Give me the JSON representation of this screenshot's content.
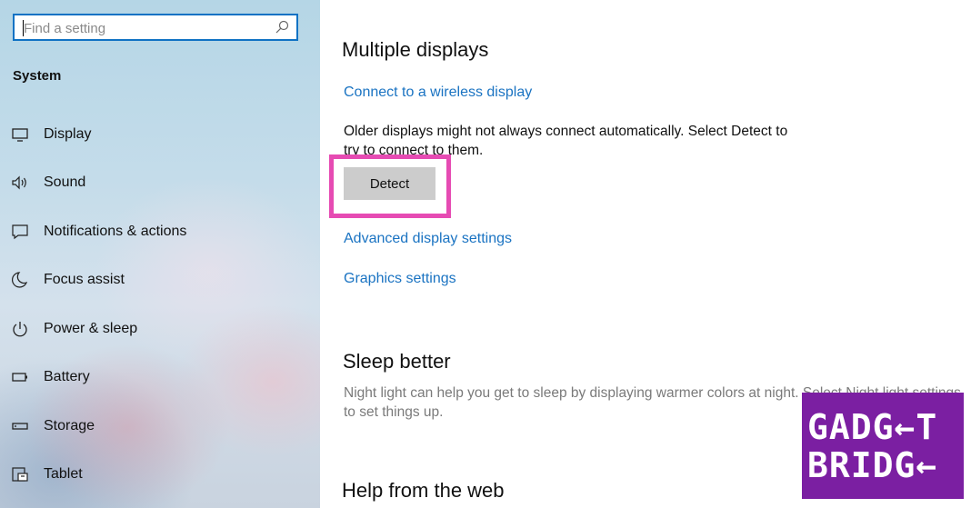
{
  "search": {
    "placeholder": "Find a setting",
    "icon": "search-icon"
  },
  "sidebar": {
    "title": "System",
    "items": [
      {
        "label": "Display",
        "icon": "monitor-icon"
      },
      {
        "label": "Sound",
        "icon": "speaker-icon"
      },
      {
        "label": "Notifications & actions",
        "icon": "notification-icon"
      },
      {
        "label": "Focus assist",
        "icon": "moon-icon"
      },
      {
        "label": "Power & sleep",
        "icon": "power-icon"
      },
      {
        "label": "Battery",
        "icon": "battery-icon"
      },
      {
        "label": "Storage",
        "icon": "storage-icon"
      },
      {
        "label": "Tablet",
        "icon": "tablet-icon"
      }
    ]
  },
  "main": {
    "multiple_displays": {
      "heading": "Multiple displays",
      "wireless_link": "Connect to a wireless display",
      "description": "Older displays might not always connect automatically. Select Detect to try to connect to them.",
      "detect_button": "Detect",
      "advanced_link": "Advanced display settings",
      "graphics_link": "Graphics settings"
    },
    "sleep_better": {
      "heading": "Sleep better",
      "description": "Night light can help you get to sleep by displaying warmer colors at night. Select Night light settings to set things up."
    },
    "help": {
      "heading": "Help from the web"
    }
  },
  "watermark": {
    "line1": "GADG←T",
    "line2": "BRIDG←"
  },
  "colors": {
    "accent": "#1a73c2",
    "highlight": "#e64bb3",
    "watermark_bg": "#7b1fa2",
    "search_border": "#0f72c4"
  }
}
